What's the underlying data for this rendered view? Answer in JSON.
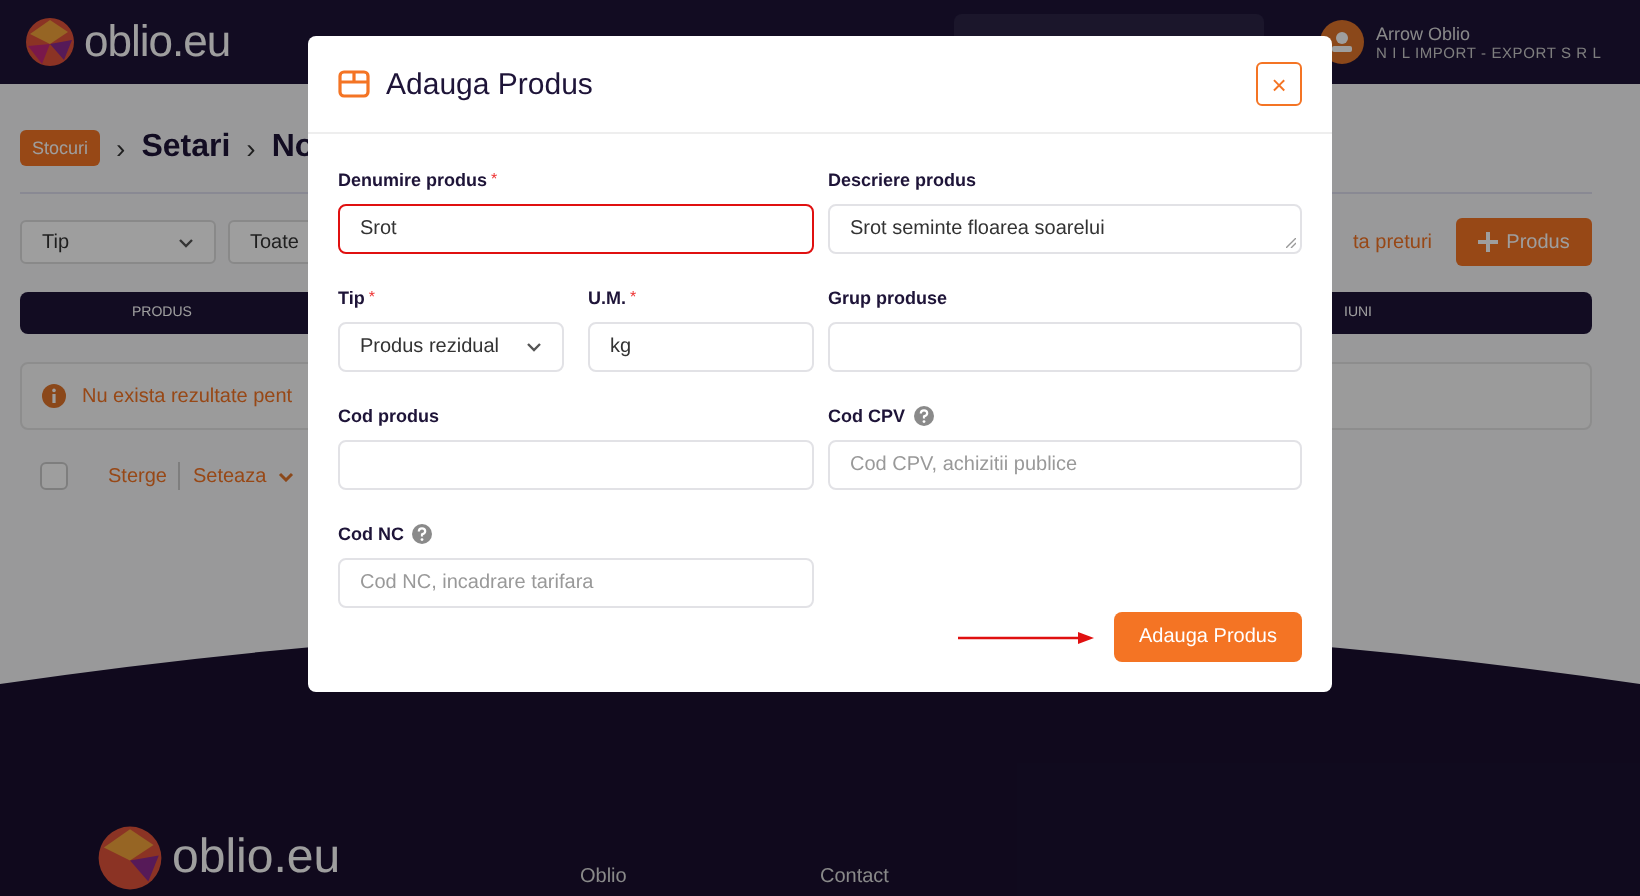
{
  "header": {
    "logo_text": "**oblio**.eu",
    "user": {
      "name": "Arrow Oblio",
      "company": "N I L IMPORT - EXPORT S R L"
    }
  },
  "breadcrumb": {
    "separator": "›",
    "items": [
      {
        "label": "Stocuri",
        "kind": "badge"
      },
      {
        "label": "Setari",
        "kind": "text"
      },
      {
        "label": "No",
        "kind": "text"
      }
    ]
  },
  "filters": [
    {
      "label": "Tip"
    },
    {
      "label": "Toate"
    }
  ],
  "price_link": "ta preturi",
  "add_button": "Produs",
  "table": {
    "columns": [
      "PRODUS",
      "IUNI"
    ]
  },
  "alert": "Nu exista rezultate pent",
  "bulk_actions": {
    "checked": false,
    "delete": "Sterge",
    "set": "Seteaza"
  },
  "footer": {
    "logo_text": "**oblio**.eu",
    "links": [
      "Oblio",
      "Contact"
    ]
  },
  "modal": {
    "title": "Adauga Produs",
    "close": "×",
    "columns": [
      [
        {
          "kind": "input",
          "label": "Denumire produs",
          "marker": "*",
          "value": "Srot",
          "invalid": true
        },
        {
          "kind": "pair",
          "fields": [
            {
              "kind": "select",
              "label": "Tip",
              "marker": "*",
              "value": "Produs rezidual",
              "invalid": false
            },
            {
              "kind": "input",
              "label": "U.M.",
              "marker": "*",
              "value": "kg",
              "invalid": false
            }
          ]
        },
        {
          "kind": "input",
          "label": "Cod produs",
          "invalid": false
        },
        {
          "kind": "input",
          "label": "Cod NC",
          "help": true,
          "placeholder": "Cod NC, incadrare tarifara",
          "invalid": false
        }
      ],
      [
        {
          "kind": "textarea",
          "label": "Descriere produs",
          "value": "Srot seminte floarea soarelui",
          "invalid": false
        },
        {
          "kind": "input",
          "label": "Grup produse",
          "invalid": false
        },
        {
          "kind": "input",
          "label": "Cod CPV",
          "help": true,
          "placeholder": "Cod CPV, achizitii publice",
          "invalid": false
        }
      ]
    ],
    "submit": "Adauga Produs"
  }
}
